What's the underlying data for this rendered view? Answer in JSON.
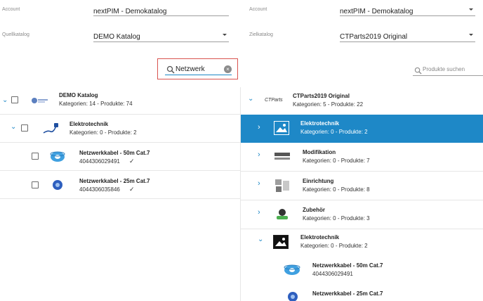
{
  "left": {
    "account": {
      "label": "Account",
      "value": "nextPIM - Demokatalog"
    },
    "source_catalog": {
      "label": "Quellkatalog",
      "value": "DEMO Katalog"
    },
    "search": {
      "value": "Netzwerk",
      "icon": "search-icon",
      "clear_icon": "clear-icon"
    },
    "tree": {
      "root": {
        "title": "DEMO Katalog",
        "subtitle": "Kategorien: 14 - Produkte: 74"
      },
      "category": {
        "title": "Elektrotechnik",
        "subtitle": "Kategorien: 0 - Produkte: 2"
      },
      "products": [
        {
          "title": "Netzwerkkabel - 50m Cat.7",
          "sku": "4044306029491",
          "check": "✓"
        },
        {
          "title": "Netzwerkkabel - 25m Cat.7",
          "sku": "4044306035846",
          "check": "✓"
        }
      ]
    }
  },
  "right": {
    "account": {
      "label": "Account",
      "value": "nextPIM - Demokatalog"
    },
    "target_catalog": {
      "label": "Zielkatalog",
      "value": "CTParts2019 Original"
    },
    "search": {
      "placeholder": "Produkte suchen"
    },
    "tree": {
      "root": {
        "logo_text": "CTParts",
        "title": "CTParts2019 Original",
        "subtitle": "Kategorien: 5 - Produkte: 22"
      },
      "categories": [
        {
          "title": "Elektrotechnik",
          "subtitle": "Kategorien: 0 - Produkte: 2",
          "highlighted": true
        },
        {
          "title": "Modifikation",
          "subtitle": "Kategorien: 0 - Produkte: 7"
        },
        {
          "title": "Einrichtung",
          "subtitle": "Kategorien: 0 - Produkte: 8"
        },
        {
          "title": "Zubehör",
          "subtitle": "Kategorien: 0 - Produkte: 3"
        },
        {
          "title": "Elektrotechnik",
          "subtitle": "Kategorien: 0 - Produkte: 2"
        }
      ],
      "products": [
        {
          "title": "Netzwerkkabel - 50m Cat.7",
          "sku": "4044306029491"
        },
        {
          "title": "Netzwerkkabel - 25m Cat.7",
          "sku": ""
        }
      ]
    }
  },
  "colors": {
    "accent": "#1e88c7",
    "highlight_bg": "#1e88c7",
    "search_focus_border": "#d9534f"
  }
}
